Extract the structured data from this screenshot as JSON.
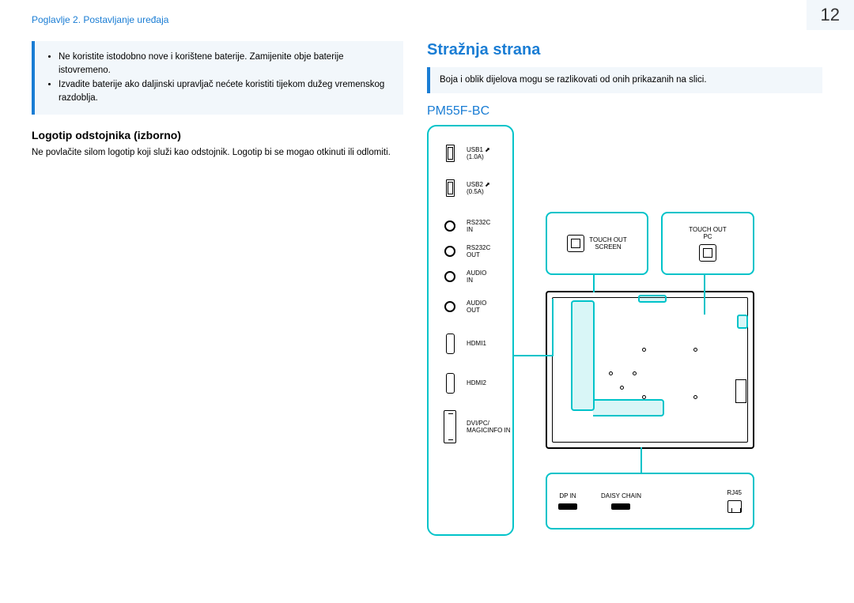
{
  "header": {
    "chapter": "Poglavlje 2. Postavljanje uređaja",
    "page_number": "12"
  },
  "left_col": {
    "bullets": [
      "Ne koristite istodobno nove i korištene baterije. Zamijenite obje baterije istovremeno.",
      "Izvadite baterije ako daljinski upravljač nećete koristiti tijekom dužeg vremenskog razdoblja."
    ],
    "logo_heading": "Logotip odstojnika (izborno)",
    "logo_text": "Ne povlačite silom logotip koji služi kao odstojnik. Logotip bi se mogao otkinuti ili odlomiti."
  },
  "right_col": {
    "rear_heading": "Stražnja strana",
    "note": "Boja i oblik dijelova mogu se razlikovati od onih prikazanih na slici.",
    "model": "PM55F-BC",
    "ports": {
      "usb1": "USB1 ⬈\n(1.0A)",
      "usb2": "USB2 ⬈\n(0.5A)",
      "rs232c_in": "RS232C\nIN",
      "rs232c_out": "RS232C\nOUT",
      "audio_in": "AUDIO\nIN",
      "audio_out": "AUDIO\nOUT",
      "hdmi1": "HDMI1",
      "hdmi2": "HDMI2",
      "dvi": "DVI/PC/\nMAGICINFO IN"
    },
    "callouts": {
      "touch_screen": "TOUCH OUT\nSCREEN",
      "touch_pc": "TOUCH OUT\nPC",
      "dp_in": "DP IN",
      "daisy": "DAISY CHAIN",
      "rj45": "RJ45"
    }
  }
}
